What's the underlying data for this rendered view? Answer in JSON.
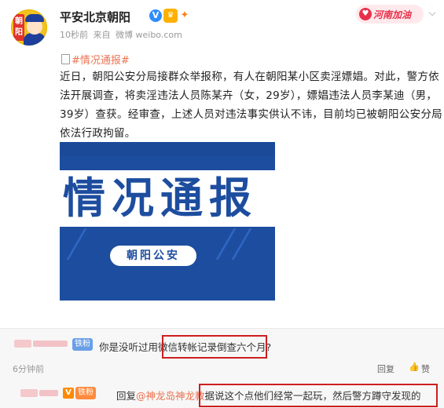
{
  "post": {
    "account_name": "平安北京朝阳",
    "verified_badge": "V",
    "meta": {
      "time": "10秒前",
      "source_prefix": "来自",
      "source": "微博 weibo.com"
    },
    "henan_badge": "河南加油",
    "avatar_text": [
      "朝",
      "阳"
    ],
    "topic": "#情况通报#",
    "body_lines": [
      "近日，朝阳公安分局接群众举报称，有人在朝阳某小区卖淫嫖娼。对此，警方依",
      "法开展调查，将卖淫违法人员陈某卉（女，29岁），嫖娼违法人员李某迪（男，",
      "39岁）查获。经审查，上述人员对违法事实供认不讳，目前均已被朝阳公安分局",
      "依法行政拘留。"
    ],
    "image": {
      "headline": "情况通报",
      "subtitle": "朝阳公安"
    }
  },
  "comments": [
    {
      "fan_badge": "铁粉",
      "text_prefix": "你是没听过用",
      "text_highlight": "微信转帐记录倒查六个月?",
      "time": "6分钟前",
      "reply_label": "回复",
      "like_label": "赞"
    },
    {
      "fan_badge": "铁粉",
      "reply_prefix": "回复",
      "reply_to": "@神龙岛神龙教",
      "text_highlight": "据说这个点他们经常一起玩，然后警方蹲守发现的"
    }
  ],
  "colors": {
    "link": "#eb7350",
    "verified": "#2e8dff",
    "highlight_box": "#cc1f1f",
    "image_bg": "#1d4d9f"
  }
}
